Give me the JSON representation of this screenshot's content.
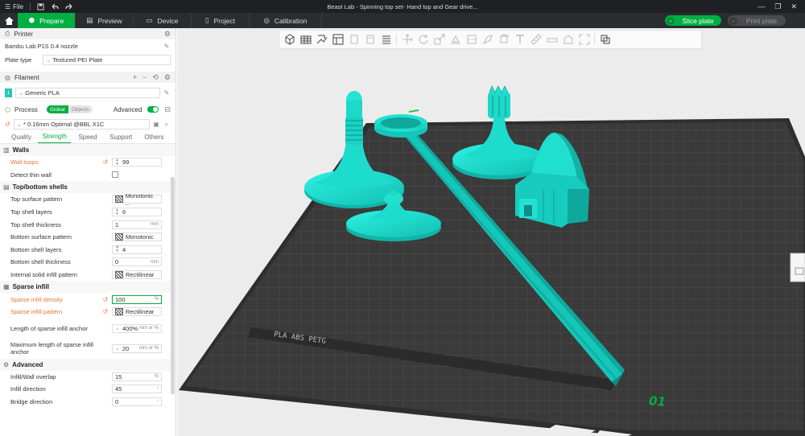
{
  "titlebar": {
    "menu_icon": "hamburger-icon",
    "file_label": "File",
    "title": "Beast Lab - Spinning top set- Hand top and Gear drive...",
    "window_controls": [
      "minimize-icon",
      "restore-icon",
      "close-icon"
    ]
  },
  "tabs": [
    {
      "label": "Prepare",
      "icon": "cube-icon",
      "active": true
    },
    {
      "label": "Preview",
      "icon": "layers-icon",
      "active": false
    },
    {
      "label": "Device",
      "icon": "monitor-icon",
      "active": false
    },
    {
      "label": "Project",
      "icon": "document-icon",
      "active": false
    },
    {
      "label": "Calibration",
      "icon": "target-icon",
      "active": false
    }
  ],
  "actions": {
    "slice": "Slice plate",
    "print": "Print plate"
  },
  "printer": {
    "section_label": "Printer",
    "name": "Bambu Lab P1S 0.4 nozzle",
    "plate_type_label": "Plate type",
    "plate_type": "Textured PEI Plate"
  },
  "filament": {
    "section_label": "Filament",
    "slot": "1",
    "name": "Generic PLA",
    "color": "#26c6b8"
  },
  "process": {
    "section_label": "Process",
    "global_label": "Global",
    "objects_label": "Objects",
    "advanced_label": "Advanced",
    "advanced_on": true,
    "preset": "* 0.16mm Optimal @BBL X1C",
    "subtabs": [
      "Quality",
      "Strength",
      "Speed",
      "Support",
      "Others"
    ],
    "active_subtab": "Strength"
  },
  "walls": {
    "title": "Walls",
    "wall_loops": {
      "label": "Wall loops",
      "value": "99"
    },
    "detect_thin_wall": {
      "label": "Detect thin wall",
      "checked": false
    }
  },
  "top_bottom": {
    "title": "Top/bottom shells",
    "top_surface_pattern": {
      "label": "Top surface pattern",
      "value": "Monotonic ..."
    },
    "top_shell_layers": {
      "label": "Top shell layers",
      "value": "6"
    },
    "top_shell_thickness": {
      "label": "Top shell thickness",
      "value": "1",
      "unit": "mm"
    },
    "bottom_surface_pattern": {
      "label": "Bottom surface pattern",
      "value": "Monotonic"
    },
    "bottom_shell_layers": {
      "label": "Bottom shell layers",
      "value": "4"
    },
    "bottom_shell_thickness": {
      "label": "Bottom shell thickness",
      "value": "0",
      "unit": "mm"
    },
    "internal_solid_pattern": {
      "label": "Internal solid infill pattern",
      "value": "Rectilinear"
    }
  },
  "sparse": {
    "title": "Sparse infill",
    "density": {
      "label": "Sparse infill density",
      "value": "100",
      "unit": "%"
    },
    "pattern": {
      "label": "Sparse infill pattern",
      "value": "Rectilinear"
    },
    "anchor": {
      "label": "Length of sparse infill anchor",
      "value": "400%",
      "unit": "mm or %"
    },
    "anchor_max": {
      "label": "Maximum length of sparse infill anchor",
      "value": "20",
      "unit": "mm or %"
    }
  },
  "advanced": {
    "title": "Advanced",
    "overlap": {
      "label": "Infill/Wall overlap",
      "value": "15",
      "unit": "%"
    },
    "direction": {
      "label": "Infill direction",
      "value": "45",
      "unit": "°"
    },
    "bridge": {
      "label": "Bridge direction",
      "value": "0",
      "unit": "°"
    }
  },
  "viewport": {
    "bed_text": "PLA ABS PETG",
    "plate_number": "01",
    "model_color": "#1ce0d0",
    "bed_color": "#3c3c3c"
  }
}
